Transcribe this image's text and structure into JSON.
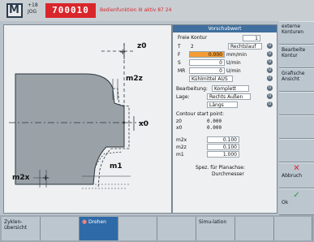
{
  "header": {
    "channel_top": "+18",
    "channel_bottom": "JOG",
    "program": "700010",
    "alarm": "Bedienfunktion III aktiv 87 24"
  },
  "form": {
    "title": "Vorschubwert",
    "rows": {
      "contour_label": "Freie Kontur",
      "contour_num": "1",
      "t_label": "T",
      "t_value": "2",
      "t_dir": "Rechtslauf",
      "f_label": "F",
      "f_value": "0.000",
      "f_unit": "mm/min",
      "s_label": "S",
      "s_value": "0",
      "s_unit": "U/min",
      "mr_label": "MR",
      "mr_value": "0",
      "mr_unit": "U/min",
      "coolant": "Kühlmittel AUS",
      "bearb_label": "Bearbeitung:",
      "bearb_value": "Komplett",
      "lage_label": "Lage:",
      "lage_value": "Rechts Außen",
      "dir_value": "Längs",
      "csp_label": "Contour start point:",
      "z0_label": "z0",
      "z0_value": "0.000",
      "x0_label": "x0",
      "x0_value": "0.000",
      "m2x_label": "m2x",
      "m2x_value": "0.100",
      "m2z_label": "m2z",
      "m2z_value": "0.100",
      "m1_label": "m1",
      "m1_value": "1.000",
      "spez_label": "Spez. für Planachse:",
      "spez_value": "Durchmesser"
    }
  },
  "graphic": {
    "labels": {
      "z0": "z0",
      "x0": "x0",
      "m2z": "m2z",
      "m2x": "m2x",
      "m1": "m1",
      "plus_z": "+",
      "plus_x": "+"
    }
  },
  "vsoftkeys": [
    {
      "label": "externe Konturen"
    },
    {
      "label": "Bearbeite Kontur"
    },
    {
      "label": "Grafische Ansicht"
    },
    {
      "label": ""
    },
    {
      "label": ""
    },
    {
      "label": ""
    },
    {
      "label": "Abbruch"
    },
    {
      "label": "Ok"
    }
  ],
  "hsoftkeys": [
    {
      "label": "Zyklen-übersicht"
    },
    {
      "label": ""
    },
    {
      "label": "Drehen"
    },
    {
      "label": ""
    },
    {
      "label": ""
    },
    {
      "label": "Simu-lation"
    },
    {
      "label": ""
    },
    {
      "label": ""
    }
  ],
  "colors": {
    "accent": "#3f6f9e",
    "highlight": "#f39c34",
    "program_bg": "#d9262b"
  }
}
